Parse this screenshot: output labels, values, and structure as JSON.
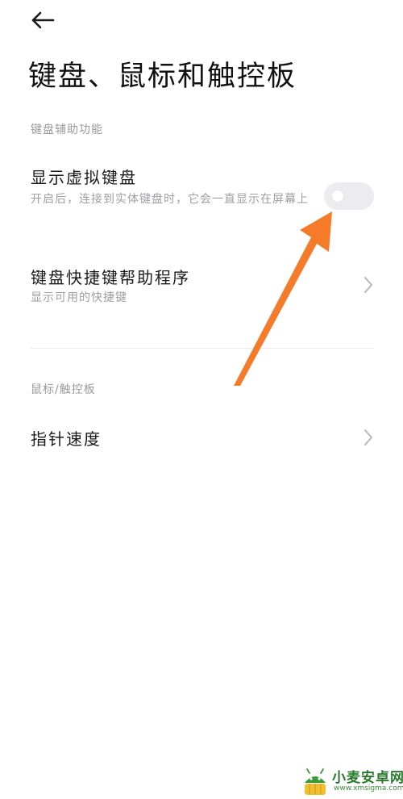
{
  "header": {
    "back_icon": "back-arrow-icon",
    "title": "键盘、鼠标和触控板"
  },
  "keyboard_section": {
    "header": "键盘辅助功能",
    "virtual_keyboard": {
      "title": "显示虚拟键盘",
      "subtitle": "开启后，连接到实体键盘时，它会一直显示在屏幕上",
      "toggle_state": "off"
    },
    "shortcut_helper": {
      "title": "键盘快捷键帮助程序",
      "subtitle": "显示可用的快捷键",
      "chevron_icon": "chevron-right-icon"
    }
  },
  "mouse_section": {
    "header": "鼠标/触控板",
    "pointer_speed": {
      "title": "指针速度",
      "chevron_icon": "chevron-right-icon"
    }
  },
  "annotation": {
    "arrow_color": "#f57a2a",
    "arrow_icon": "orange-pointer-arrow"
  },
  "watermark": {
    "name": "小麦安卓网",
    "url": "www.xmsigma.com",
    "logo_color": "#3a9a3a"
  }
}
